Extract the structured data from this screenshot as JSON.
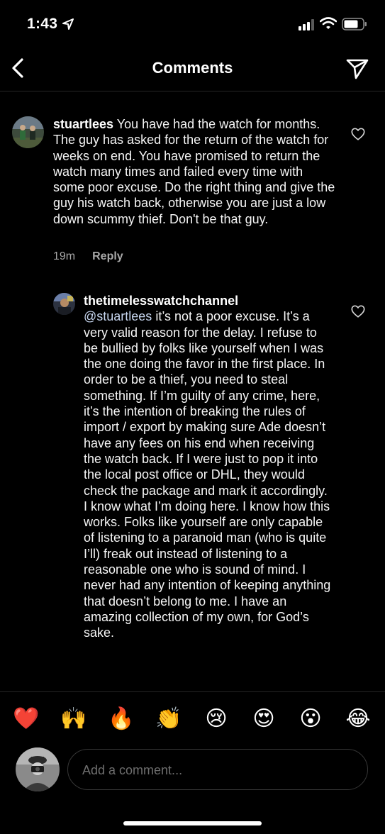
{
  "status_bar": {
    "time": "1:43"
  },
  "header": {
    "title": "Comments"
  },
  "comments": [
    {
      "username": "stuartlees",
      "text": " You have had the watch for months. The guy has asked for the return of the watch for weeks on end. You have promised to return the watch many times and failed every time with some poor excuse. Do the right thing and give the guy his watch back, otherwise you are just a low down scummy thief. Don't be that guy.",
      "time": "19m",
      "reply_label": "Reply"
    },
    {
      "username": "thetimelesswatchchannel",
      "mention": "@stuartlees",
      "text": " it’s not a poor excuse. It’s a very valid reason for the delay. I refuse to be bullied by folks like yourself when I was the one doing the favor in the first place. In order to be a thief, you need to steal something. If I’m guilty of any crime, here, it’s the intention of breaking the rules of import / export by making sure Ade doesn’t have any fees on his end when receiving the watch back. If I were just to pop it into the local post office or DHL, they would check the package and mark it accordingly. I know what I’m doing here. I know how this works. Folks like yourself are only capable of listening to a paranoid man (who is quite I’ll) freak out instead of listening to a reasonable one who is sound of mind. I never had any intention of keeping anything that doesn’t belong to me. I have an amazing collection of my own, for God’s sake."
    }
  ],
  "emoji_bar": [
    "❤️",
    "🙌",
    "🔥",
    "👏",
    "😢",
    "😍",
    "😮",
    "😂"
  ],
  "composer": {
    "placeholder": "Add a comment..."
  }
}
